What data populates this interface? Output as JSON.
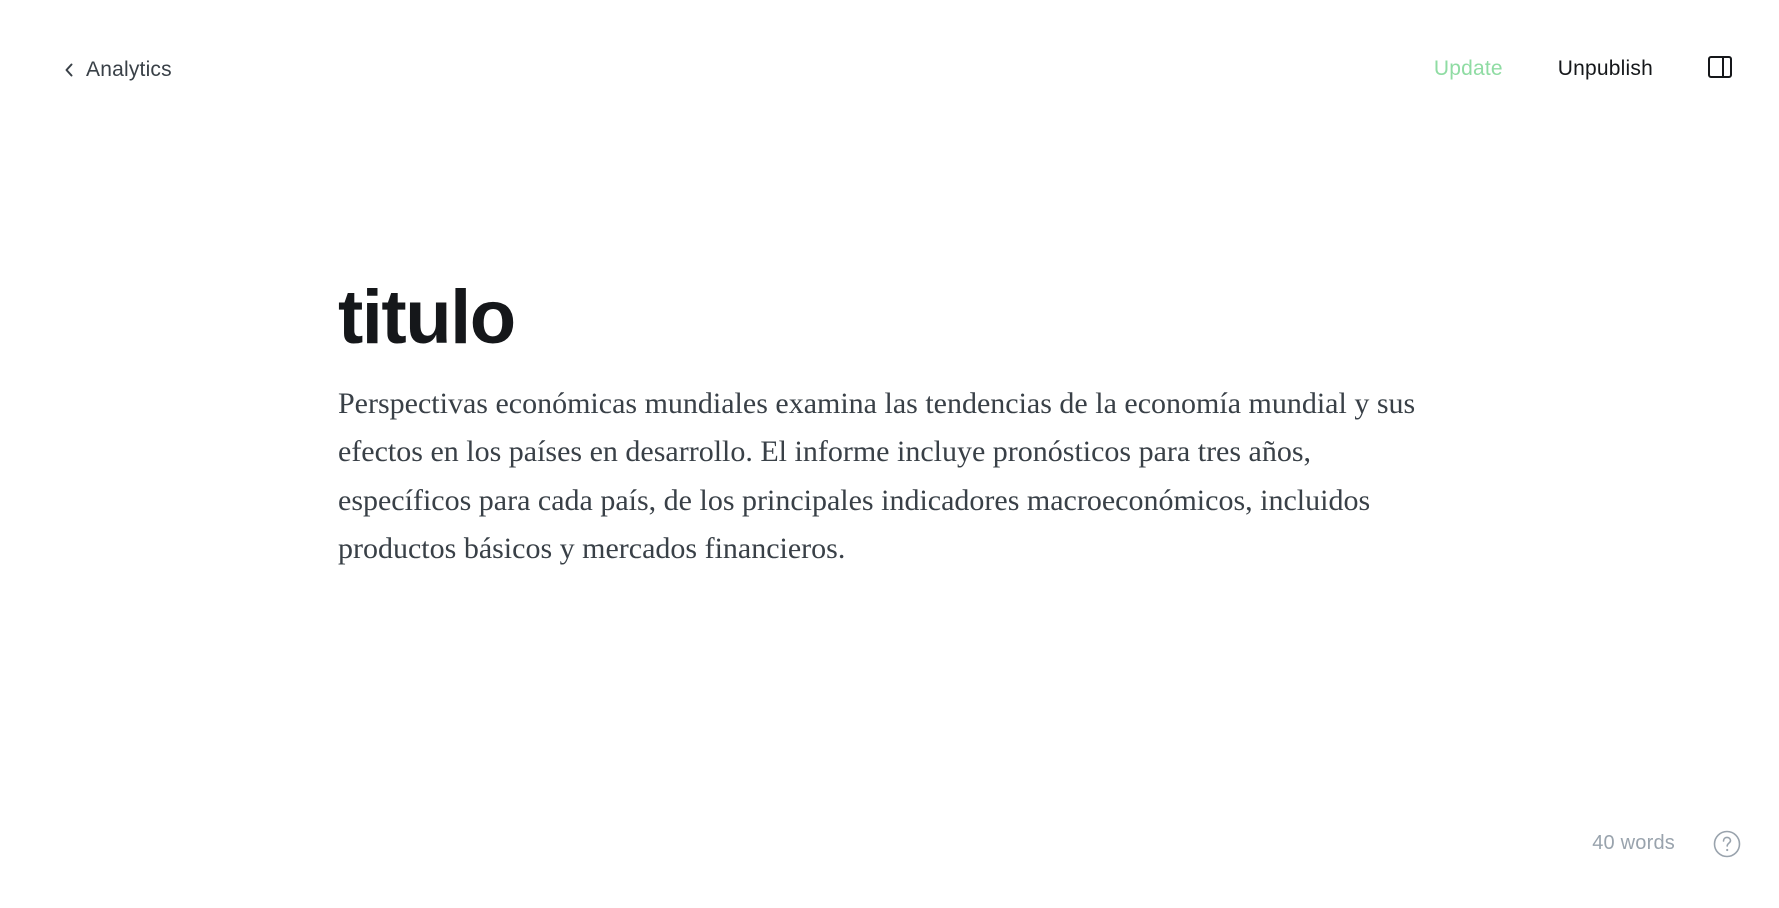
{
  "header": {
    "back_label": "Analytics",
    "update_label": "Update",
    "unpublish_label": "Unpublish"
  },
  "icons": {
    "back": "chevron-left-icon",
    "sidebar": "sidebar-toggle-icon",
    "help": "question-circle-icon"
  },
  "post": {
    "title": "titulo",
    "body": "Perspectivas económicas mundiales examina las tendencias de la economía mundial y sus efectos en los países en desarrollo. El informe incluye pronósticos para tres años, específicos para cada país, de los principales indicadores macroeconómicos, incluidos productos básicos y mercados financieros."
  },
  "footer": {
    "word_count": "40 words"
  },
  "colors": {
    "update_accent": "#8fdca3",
    "text_primary": "#15171a",
    "text_secondary": "#394047",
    "text_muted": "#99a3ad"
  }
}
